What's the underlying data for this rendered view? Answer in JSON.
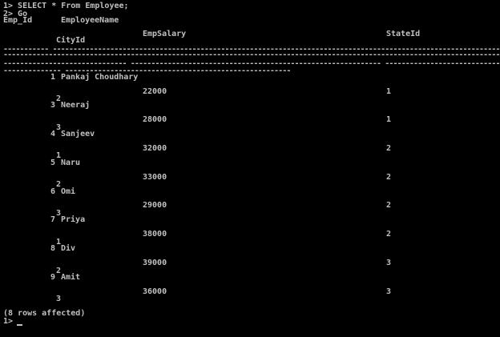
{
  "commands": {
    "clipped_top_line": "------------------------ ----- -",
    "line1": "1> SELECT * From Employee;",
    "line2": "2> Go"
  },
  "headers": {
    "emp_id": "Emp_Id",
    "employee_name": "EmployeeName",
    "emp_salary": "EmpSalary",
    "state_id": "StateId",
    "city_id": "CityId"
  },
  "separators": {
    "line1": "----------- ------------------------------------------------------------------------------------------------------------------------------------------------------------------------------------------------------------------------",
    "line2": "---------------------------------------------------------------------------------------------------------------------------------------------------------------------------------------------------------------------------------",
    "line3": "------------------------------ ------------------------------------------------------------- ------------------------------------------------",
    "line4": "-------------- -------------------------------------------------------"
  },
  "rows": [
    {
      "emp_id": "1",
      "employee_name": "Pankaj Choudhary",
      "emp_salary": "22000",
      "state_id": "1",
      "city_id": "2"
    },
    {
      "emp_id": "3",
      "employee_name": "Neeraj",
      "emp_salary": "28000",
      "state_id": "1",
      "city_id": "3"
    },
    {
      "emp_id": "4",
      "employee_name": "Sanjeev",
      "emp_salary": "32000",
      "state_id": "2",
      "city_id": "1"
    },
    {
      "emp_id": "5",
      "employee_name": "Naru",
      "emp_salary": "33000",
      "state_id": "2",
      "city_id": "2"
    },
    {
      "emp_id": "6",
      "employee_name": "Omi",
      "emp_salary": "29000",
      "state_id": "2",
      "city_id": "3"
    },
    {
      "emp_id": "7",
      "employee_name": "Priya",
      "emp_salary": "38000",
      "state_id": "2",
      "city_id": "1"
    },
    {
      "emp_id": "8",
      "employee_name": "Div",
      "emp_salary": "39000",
      "state_id": "3",
      "city_id": "2"
    },
    {
      "emp_id": "9",
      "employee_name": "Amit",
      "emp_salary": "36000",
      "state_id": "3",
      "city_id": "3"
    }
  ],
  "footer": {
    "rows_affected": "(8 rows affected)",
    "prompt": "1>"
  },
  "colors": {
    "background": "#000000",
    "text": "#c0c0c0"
  }
}
